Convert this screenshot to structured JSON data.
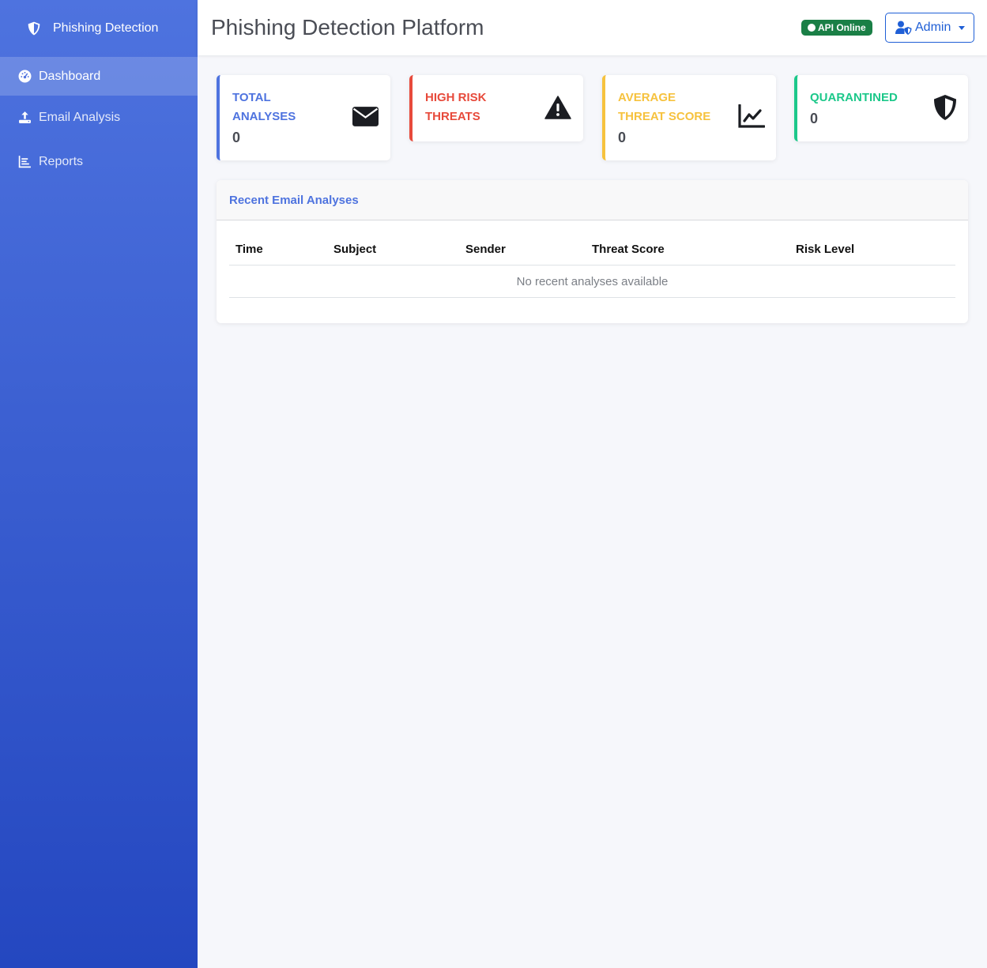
{
  "sidebar": {
    "brand": "Phishing Detection",
    "items": [
      {
        "label": "Dashboard",
        "icon": "dashboard-icon",
        "active": true
      },
      {
        "label": "Email Analysis",
        "icon": "upload-icon",
        "active": false
      },
      {
        "label": "Reports",
        "icon": "chart-icon",
        "active": false
      }
    ]
  },
  "header": {
    "title": "Phishing Detection Platform",
    "api_status": "API Online",
    "user_label": "Admin"
  },
  "cards": [
    {
      "label": "Total Analyses",
      "value": "0",
      "color": "#4e73df",
      "icon": "envelope-icon"
    },
    {
      "label": "High Risk Threats",
      "value": "0",
      "color": "#e74a3b",
      "icon": "warning-icon"
    },
    {
      "label": "Average Threat Score",
      "value": "0",
      "color": "#f6c23e",
      "icon": "line-chart-icon"
    },
    {
      "label": "Quarantined",
      "value": "0",
      "color": "#1cc88a",
      "icon": "shield-icon"
    }
  ],
  "recent": {
    "title": "Recent Email Analyses",
    "columns": [
      "Time",
      "Subject",
      "Sender",
      "Threat Score",
      "Risk Level"
    ],
    "empty_message": "No recent analyses available"
  },
  "colors": {
    "primary": "#4e73df",
    "sidebar_bottom": "#2447c0",
    "api_online": "#1a7f46",
    "admin_button": "#1f5fd6"
  }
}
